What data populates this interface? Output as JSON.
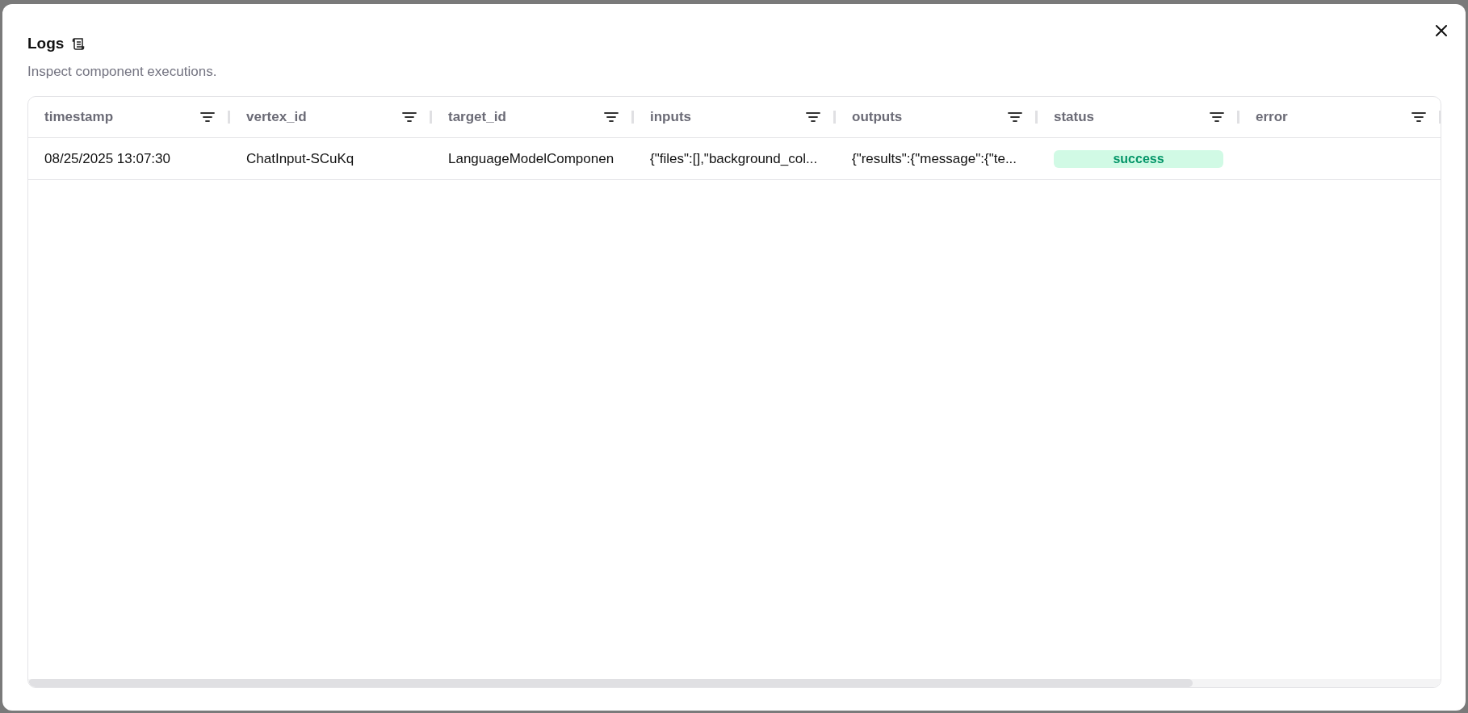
{
  "dialog": {
    "title": "Logs",
    "description": "Inspect component executions."
  },
  "table": {
    "columns": [
      "timestamp",
      "vertex_id",
      "target_id",
      "inputs",
      "outputs",
      "status",
      "error"
    ],
    "rows": [
      {
        "cells": [
          {
            "kind": "text",
            "text": "08/25/2025 13:07:30"
          },
          {
            "kind": "text",
            "text": "ChatInput-SCuKq"
          },
          {
            "kind": "text",
            "text": "LanguageModelComponen"
          },
          {
            "kind": "text",
            "text": "{\"files\":[],\"background_col..."
          },
          {
            "kind": "text",
            "text": "{\"results\":{\"message\":{\"te..."
          },
          {
            "kind": "success",
            "text": "success"
          },
          {
            "kind": "empty"
          }
        ]
      }
    ]
  }
}
